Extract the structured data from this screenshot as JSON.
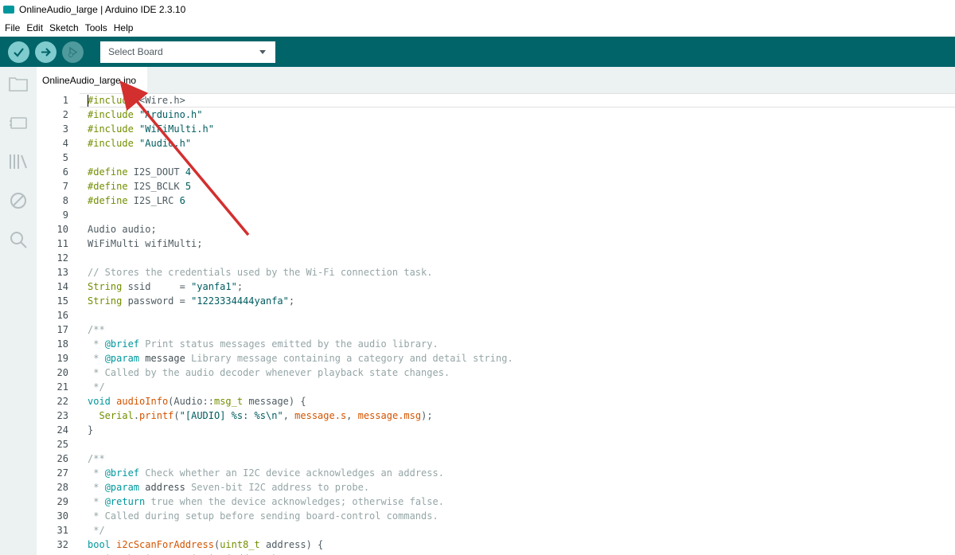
{
  "window": {
    "title": "OnlineAudio_large | Arduino IDE 2.3.10"
  },
  "menu": [
    "File",
    "Edit",
    "Sketch",
    "Tools",
    "Help"
  ],
  "toolbar": {
    "verify_icon": "check-icon",
    "upload_icon": "arrow-right-icon",
    "debug_icon": "debug-icon",
    "board_select": "Select Board"
  },
  "sidebar": [
    "folder-icon",
    "board-icon",
    "library-icon",
    "debug-icon",
    "search-icon"
  ],
  "tab": {
    "label": "OnlineAudio_large.ino"
  },
  "colors": {
    "toolbar": "#006468",
    "accent": "#00979c",
    "sidebar": "#ecf1f1",
    "annotation_arrow": "#d32f2f"
  },
  "code_lines": [
    "#include <Wire.h>",
    "#include \"Arduino.h\"",
    "#include \"WiFiMulti.h\"",
    "#include \"Audio.h\"",
    "",
    "#define I2S_DOUT 4",
    "#define I2S_BCLK 5",
    "#define I2S_LRC 6",
    "",
    "Audio audio;",
    "WiFiMulti wifiMulti;",
    "",
    "// Stores the credentials used by the Wi-Fi connection task.",
    "String ssid     = \"yanfa1\";",
    "String password = \"1223334444yanfa\";",
    "",
    "/**",
    " * @brief Print status messages emitted by the audio library.",
    " * @param message Library message containing a category and detail string.",
    " * Called by the audio decoder whenever playback state changes.",
    " */",
    "void audioInfo(Audio::msg_t message) {",
    "  Serial.printf(\"[AUDIO] %s: %s\\n\", message.s, message.msg);",
    "}",
    "",
    "/**",
    " * @brief Check whether an I2C device acknowledges an address.",
    " * @param address Seven-bit I2C address to probe.",
    " * @return true when the device acknowledges; otherwise false.",
    " * Called during setup before sending board-control commands.",
    " */",
    "bool i2cScanForAddress(uint8_t address) {",
    "  Wire.beginTransmission(address);"
  ]
}
